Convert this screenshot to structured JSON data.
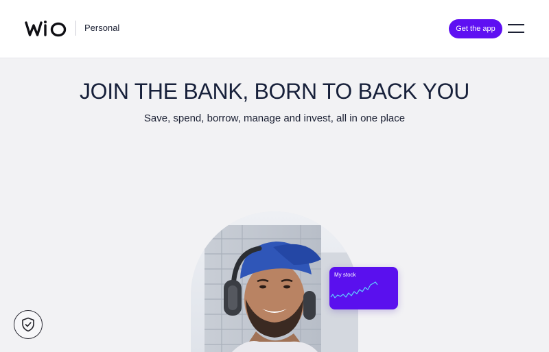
{
  "header": {
    "brand": "Wio",
    "segment": "Personal",
    "cta_label": "Get the app"
  },
  "hero": {
    "title": "JOIN THE BANK, BORN TO BACK YOU",
    "subtitle": "Save, spend, borrow, manage and invest, all in one place"
  },
  "stock_card": {
    "label": "My stock"
  },
  "icons": {
    "menu": "hamburger-menu-icon",
    "security": "shield-check-icon"
  },
  "colors": {
    "accent": "#5e10f2",
    "stock_card": "#5a10ee",
    "background": "#f2f2f4",
    "header_bg": "#ffffff",
    "text": "#1b2033"
  }
}
